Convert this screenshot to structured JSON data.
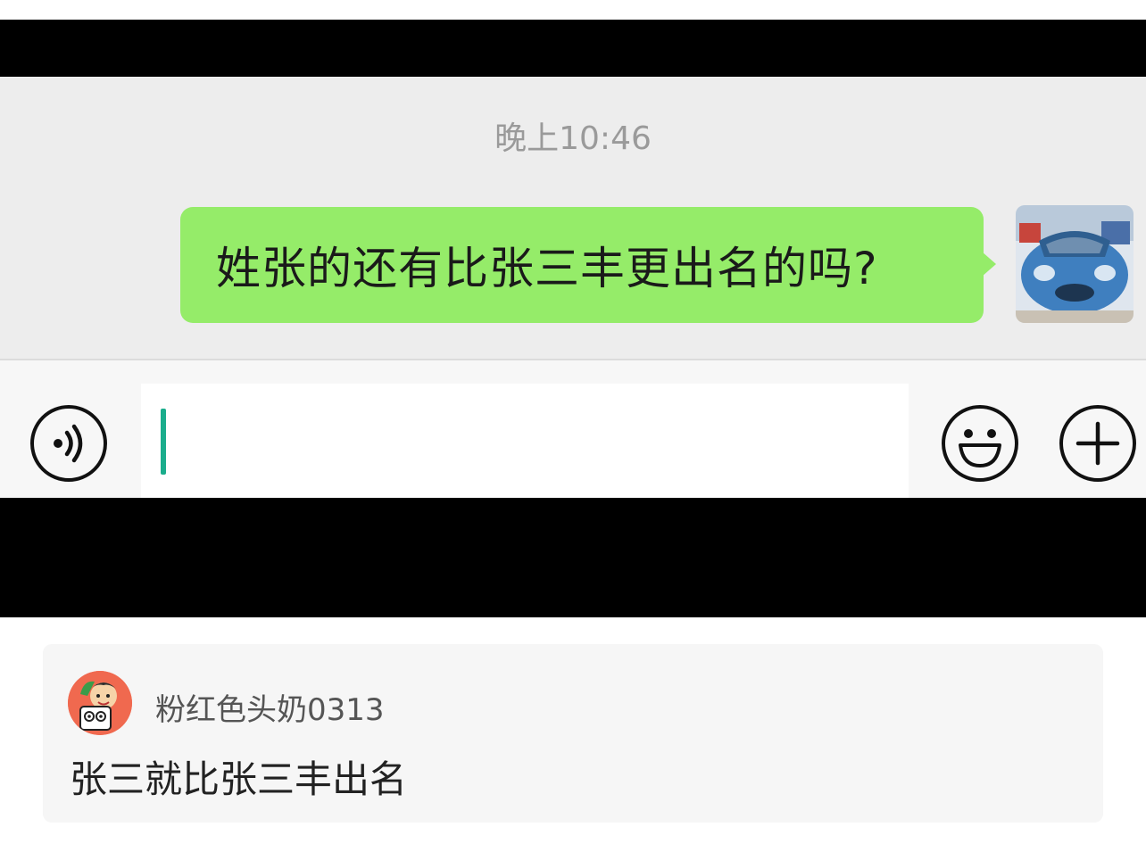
{
  "chat": {
    "timestamp": "晚上10:46",
    "messages": [
      {
        "sender": "self",
        "text": "姓张的还有比张三丰更出名的吗?",
        "bubble_color": "#95ec69"
      }
    ]
  },
  "input_bar": {
    "value": "",
    "icons": [
      "voice-icon",
      "emoji-icon",
      "plus-icon"
    ],
    "caret_color": "#1aad8c"
  },
  "comment": {
    "username": "粉红色头奶0313",
    "text": "张三就比张三丰出名",
    "avatar_bg": "#f0694f"
  }
}
